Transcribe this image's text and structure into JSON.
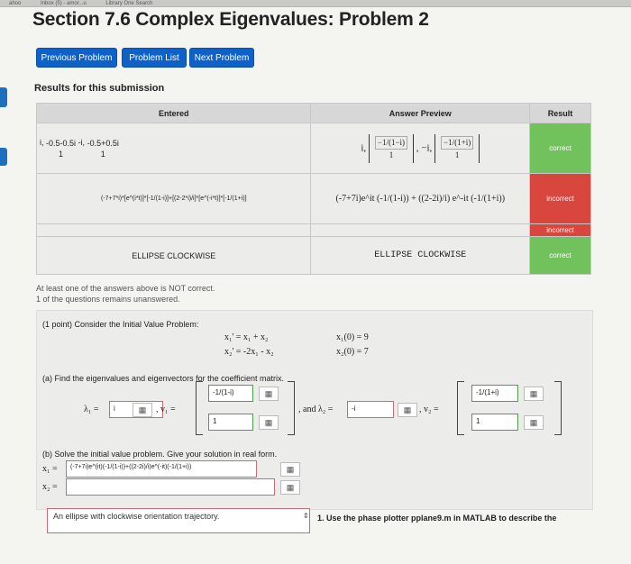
{
  "browser": {
    "tabs": [
      "ahoo",
      "Inbox (5) - amor...u",
      "Library One Search"
    ]
  },
  "page_title": "Section 7.6 Complex Eigenvalues: Problem 2",
  "nav": {
    "previous": "Previous Problem",
    "list": "Problem List",
    "next": "Next Problem"
  },
  "results": {
    "heading": "Results for this submission",
    "headers": {
      "entered": "Entered",
      "preview": "Answer Preview",
      "result": "Result"
    },
    "rows": [
      {
        "entered": "i, [-0.5-0.5i, 1], -i, [-0.5+0.5i, 1]",
        "preview": "i, [ -1/(1-i) ; 1 ], -i, [ -1/(1+i) ; 1 ]",
        "result": "correct"
      },
      {
        "entered": "(-7+7*i)*[e^(i*t)]*[-1/(1-i)]+[(2-2*i)/i]*[e^(-i*t)]*[-1/(1+i)]",
        "preview": "(-7+7i)e^it (-1/(1-i)) + ((2-2i)/i) e^-it (-1/(1+i))",
        "result": "incorrect"
      },
      {
        "entered": "",
        "preview": "",
        "result": "incorrect"
      },
      {
        "entered": "ELLIPSE CLOCKWISE",
        "preview": "ELLIPSE CLOCKWISE",
        "result": "correct"
      }
    ]
  },
  "messages": {
    "not_correct": "At least one of the answers above is NOT correct.",
    "unanswered": "1 of the questions remains unanswered."
  },
  "problem": {
    "intro": "(1 point) Consider the Initial Value Problem:",
    "eq1_lhs": "x₁' = x₁ + x₂",
    "eq2_lhs": "x₂' = -2x₁ - x₂",
    "ic1": "x₁(0) = 9",
    "ic2": "x₂(0) = 7",
    "part_a": "(a) Find the eigenvalues and eigenvectors for the coefficient matrix.",
    "lambda1_label": "λ₁ =",
    "lambda1_value": "i",
    "v1_label": ", v₁ =",
    "v1_top": "-1/(1-i)",
    "v1_bottom": "1",
    "and_label": ", and λ₂ =",
    "lambda2_value": "-i",
    "v2_label": ", v₂ =",
    "v2_top": "-1/(1+i)",
    "v2_bottom": "1",
    "part_b": "(b) Solve the initial value problem. Give your solution in real form.",
    "x1_label": "x₁ =",
    "x1_value": "(-7+7i)e^(it)(-1/(1-i))+((2-2i)/i)e^(-it)(-1/(1+i))",
    "x2_label": "x₂ =",
    "x2_value": ""
  },
  "orientation": {
    "selected": "An ellipse with clockwise orientation trajectory.",
    "instruction": "1. Use the phase plotter pplane9.m in MATLAB to describe the"
  },
  "icons": {
    "matrix": "matrix-grid-icon",
    "select": "updown-arrows-icon"
  },
  "colors": {
    "correct": "#71c15d",
    "incorrect": "#d9463e",
    "button": "#0d61c9"
  }
}
